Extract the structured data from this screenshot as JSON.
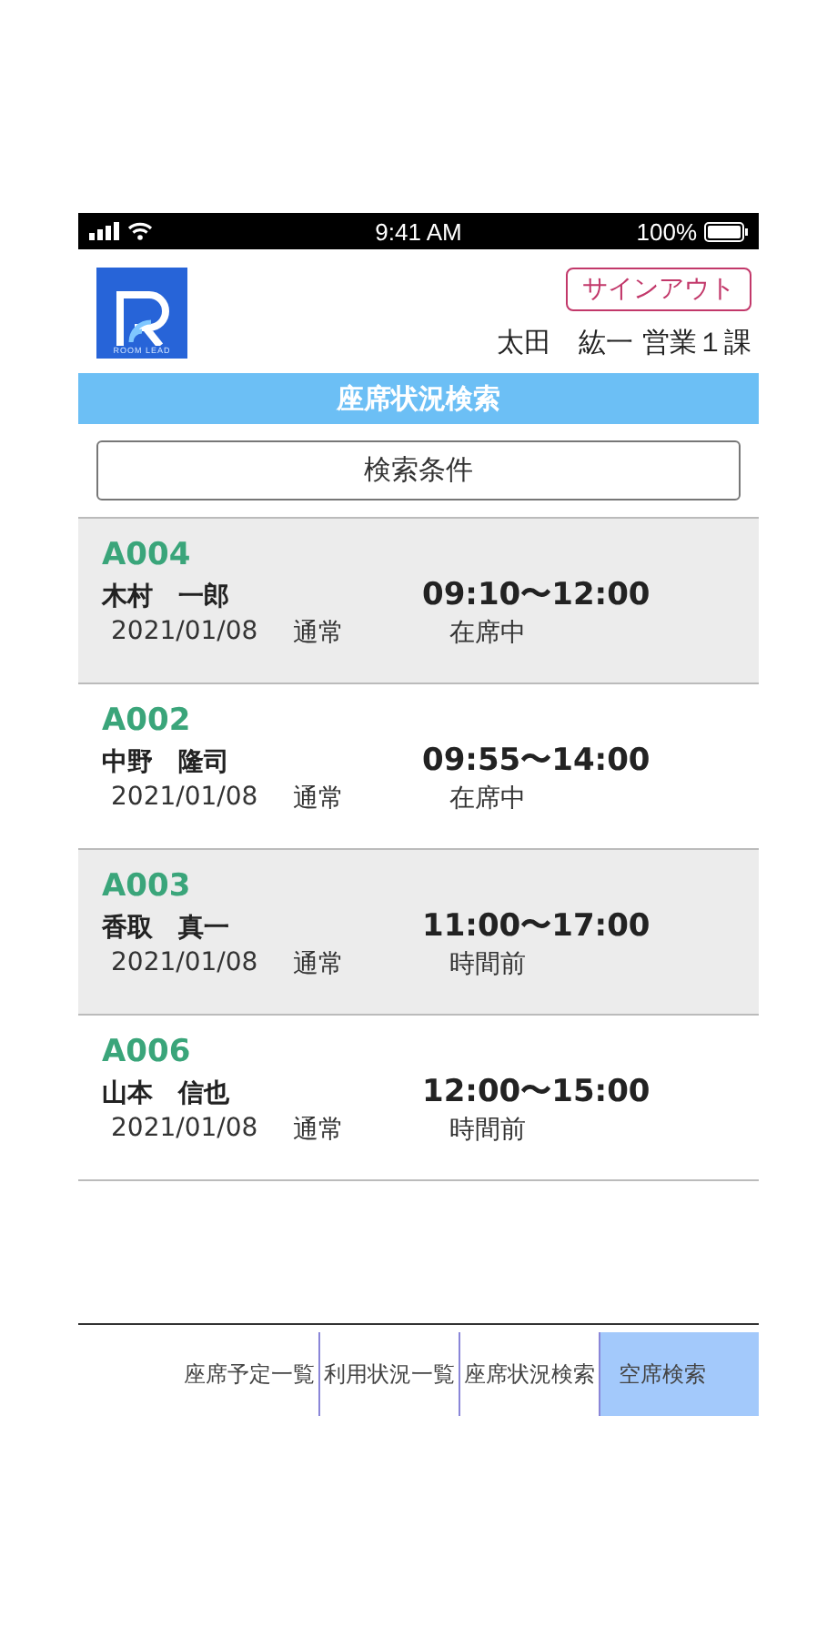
{
  "status_bar": {
    "time": "9:41 AM",
    "battery": "100%"
  },
  "header": {
    "logo_text": "ROOM LEAD",
    "signout": "サインアウト",
    "user": "太田　紘一 営業１課"
  },
  "title": "座席状況検索",
  "search_button": "検索条件",
  "reservations": [
    {
      "seat": "A004",
      "name": "木村　一郎",
      "time": "09:10〜12:00",
      "date": "2021/01/08",
      "type": "通常",
      "status": "在席中"
    },
    {
      "seat": "A002",
      "name": "中野　隆司",
      "time": "09:55〜14:00",
      "date": "2021/01/08",
      "type": "通常",
      "status": "在席中"
    },
    {
      "seat": "A003",
      "name": "香取　真一",
      "time": "11:00〜17:00",
      "date": "2021/01/08",
      "type": "通常",
      "status": "時間前"
    },
    {
      "seat": "A006",
      "name": "山本　信也",
      "time": "12:00〜15:00",
      "date": "2021/01/08",
      "type": "通常",
      "status": "時間前"
    }
  ],
  "tabs": [
    {
      "label": "座席予定一覧",
      "selected": false
    },
    {
      "label": "利用状況一覧",
      "selected": false
    },
    {
      "label": "座席状況検索",
      "selected": false
    },
    {
      "label": "空席検索",
      "selected": true
    }
  ]
}
